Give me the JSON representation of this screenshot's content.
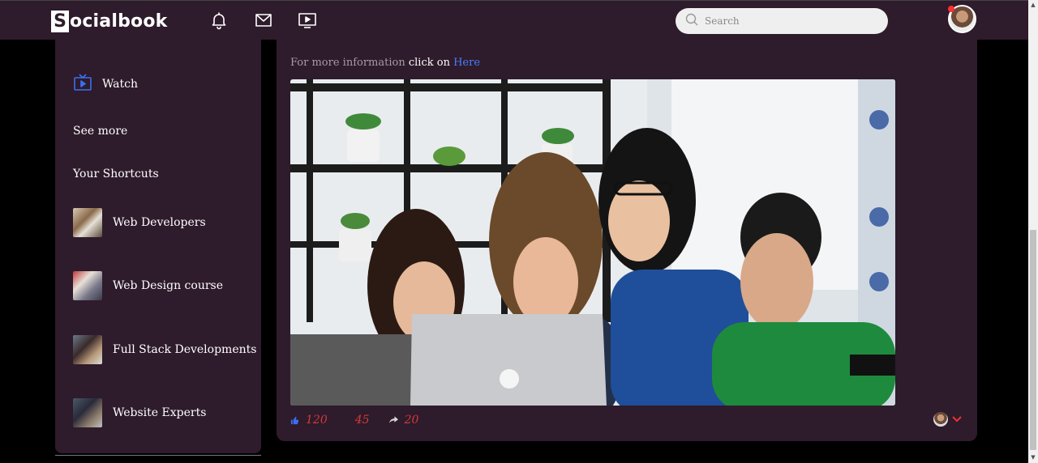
{
  "navbar": {
    "logo_letter": "S",
    "logo_rest": "ocialbook",
    "icons": [
      "bell-icon",
      "mail-icon",
      "video-icon"
    ],
    "search_placeholder": "Search"
  },
  "sidebar": {
    "watch_label": "Watch",
    "see_more": "See more",
    "shortcuts_heading": "Your Shortcuts",
    "shortcuts": [
      {
        "label": "Web Developers"
      },
      {
        "label": "Web Design course"
      },
      {
        "label": "Full Stack Developments"
      },
      {
        "label": "Website Experts"
      }
    ]
  },
  "post": {
    "info_prefix": "For more information ",
    "info_click": "click on ",
    "info_link": "Here",
    "likes": "120",
    "comments": "45",
    "shares": "20"
  },
  "colors": {
    "panel_bg": "#2e1b2b",
    "page_bg": "#000000",
    "link": "#4a7dff",
    "count_red": "#d33a3a",
    "notification_dot": "#ff3030"
  }
}
